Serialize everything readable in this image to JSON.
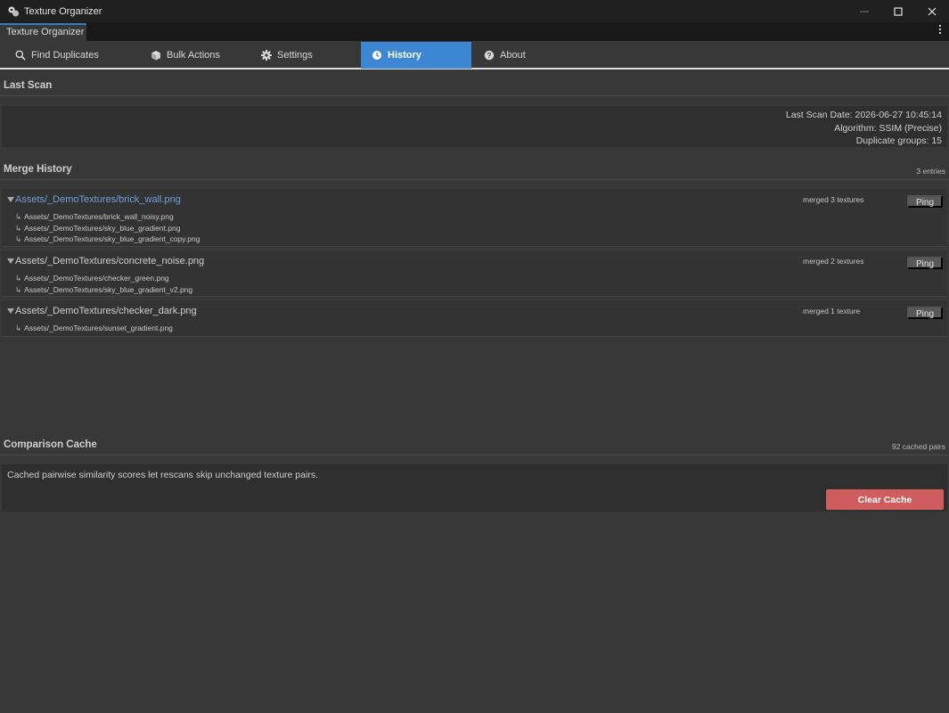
{
  "window": {
    "title": "Texture Organizer"
  },
  "dock": {
    "tab_label": "Texture Organizer"
  },
  "tabs": [
    {
      "label": "Find Duplicates",
      "icon": "search-icon"
    },
    {
      "label": "Bulk Actions",
      "icon": "cube-icon"
    },
    {
      "label": "Settings",
      "icon": "gear-icon"
    },
    {
      "label": "History",
      "icon": "clock-icon",
      "active": true
    },
    {
      "label": "About",
      "icon": "help-icon"
    }
  ],
  "last_scan": {
    "header": "Last Scan",
    "date_line": "Last Scan Date: 2026-06-27 10:45:14",
    "algorithm_line": "Algorithm: SSIM (Precise)",
    "groups_line": "Duplicate groups: 15"
  },
  "merge_history": {
    "header": "Merge History",
    "count_label": "3 entries",
    "ping_label": "Ping",
    "sub_arrow": "↳",
    "entries": [
      {
        "path": "Assets/_DemoTextures/brick_wall.png",
        "merged_label": "merged 3 textures",
        "merged": [
          "Assets/_DemoTextures/brick_wall_noisy.png",
          "Assets/_DemoTextures/sky_blue_gradient.png",
          "Assets/_DemoTextures/sky_blue_gradient_copy.png"
        ]
      },
      {
        "path": "Assets/_DemoTextures/concrete_noise.png",
        "merged_label": "merged 2 textures",
        "merged": [
          "Assets/_DemoTextures/checker_green.png",
          "Assets/_DemoTextures/sky_blue_gradient_v2.png"
        ]
      },
      {
        "path": "Assets/_DemoTextures/checker_dark.png",
        "merged_label": "merged 1 texture",
        "merged": [
          "Assets/_DemoTextures/sunset_gradient.png"
        ]
      }
    ]
  },
  "comparison_cache": {
    "header": "Comparison Cache",
    "count_label": "92 cached pairs",
    "description": "Cached pairwise similarity scores let rescans skip unchanged texture pairs.",
    "clear_label": "Clear Cache"
  },
  "colors": {
    "accent": "#3d86d4",
    "danger": "#d05d5d",
    "link": "#6f9fde",
    "background": "#383838"
  }
}
